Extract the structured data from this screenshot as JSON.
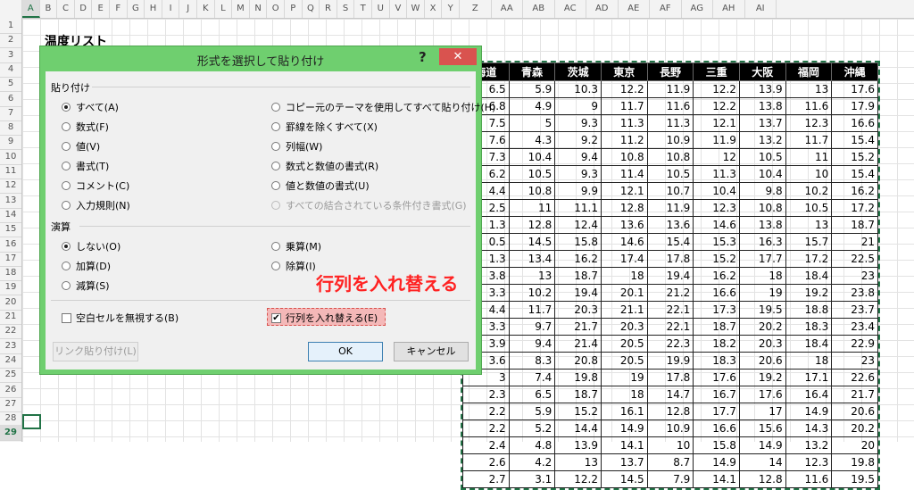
{
  "sheet": {
    "columns": [
      "A",
      "B",
      "C",
      "D",
      "E",
      "F",
      "G",
      "H",
      "I",
      "J",
      "K",
      "L",
      "M",
      "N",
      "O",
      "P",
      "Q",
      "R",
      "S",
      "T",
      "U",
      "V",
      "W",
      "X",
      "Y",
      "Z",
      "AA",
      "AB",
      "AC",
      "AD",
      "AE",
      "AF",
      "AG",
      "AH",
      "AI"
    ],
    "active_column": "A",
    "rows": [
      "1",
      "2",
      "3",
      "4",
      "5",
      "6",
      "7",
      "8",
      "9",
      "10",
      "11",
      "12",
      "13",
      "14",
      "15",
      "16",
      "17",
      "18",
      "19",
      "20",
      "21",
      "22",
      "23",
      "24",
      "25",
      "26",
      "27",
      "28",
      "29"
    ],
    "active_row": "29",
    "title": "温度リスト",
    "table_headers": [
      "海道",
      "青森",
      "茨城",
      "東京",
      "長野",
      "三重",
      "大阪",
      "福岡",
      "沖縄"
    ],
    "table_rows": [
      [
        "6.5",
        "5.9",
        "10.3",
        "12.2",
        "11.9",
        "12.2",
        "13.9",
        "13",
        "17.6"
      ],
      [
        "6.8",
        "4.9",
        "9",
        "11.7",
        "11.6",
        "12.2",
        "13.8",
        "11.6",
        "17.9"
      ],
      [
        "7.5",
        "5",
        "9.3",
        "11.3",
        "11.3",
        "12.1",
        "13.7",
        "12.3",
        "16.6"
      ],
      [
        "7.6",
        "4.3",
        "9.2",
        "11.2",
        "10.9",
        "11.9",
        "13.2",
        "11.7",
        "15.4"
      ],
      [
        "7.3",
        "10.4",
        "9.4",
        "10.8",
        "10.8",
        "12",
        "10.5",
        "11",
        "15.2"
      ],
      [
        "6.2",
        "10.5",
        "9.3",
        "11.4",
        "10.5",
        "11.3",
        "10.4",
        "10",
        "15.4"
      ],
      [
        "4.4",
        "10.8",
        "9.9",
        "12.1",
        "10.7",
        "10.4",
        "9.8",
        "10.2",
        "16.2"
      ],
      [
        "2.5",
        "11",
        "11.1",
        "12.8",
        "11.9",
        "12.3",
        "10.8",
        "10.5",
        "17.2"
      ],
      [
        "1.3",
        "12.8",
        "12.4",
        "13.6",
        "13.6",
        "14.6",
        "13.8",
        "13",
        "18.7"
      ],
      [
        "0.5",
        "14.5",
        "15.8",
        "14.6",
        "15.4",
        "15.3",
        "16.3",
        "15.7",
        "21"
      ],
      [
        "1.3",
        "13.4",
        "16.2",
        "17.4",
        "17.8",
        "15.2",
        "17.7",
        "17.2",
        "22.5"
      ],
      [
        "3.8",
        "13",
        "18.7",
        "18",
        "19.4",
        "16.2",
        "18",
        "18.4",
        "23"
      ],
      [
        "3.3",
        "10.2",
        "19.4",
        "20.1",
        "21.2",
        "16.6",
        "19",
        "19.2",
        "23.8"
      ],
      [
        "4.4",
        "11.7",
        "20.3",
        "21.1",
        "22.1",
        "17.3",
        "19.5",
        "18.8",
        "23.7"
      ],
      [
        "3.3",
        "9.7",
        "21.7",
        "20.3",
        "22.1",
        "18.7",
        "20.2",
        "18.3",
        "23.4"
      ],
      [
        "3.9",
        "9.4",
        "21.4",
        "20.5",
        "22.3",
        "18.2",
        "20.3",
        "18.4",
        "22.9"
      ],
      [
        "3.6",
        "8.3",
        "20.8",
        "20.5",
        "19.9",
        "18.3",
        "20.6",
        "18",
        "23"
      ],
      [
        "3",
        "7.4",
        "19.8",
        "19",
        "17.8",
        "17.6",
        "19.2",
        "17.1",
        "22.6"
      ],
      [
        "2.3",
        "6.5",
        "18.7",
        "18",
        "14.7",
        "16.7",
        "17.6",
        "16.4",
        "21.7"
      ],
      [
        "2.2",
        "5.9",
        "15.2",
        "16.1",
        "12.8",
        "17.7",
        "17",
        "14.9",
        "20.6"
      ],
      [
        "2.2",
        "5.2",
        "14.4",
        "14.9",
        "10.9",
        "16.6",
        "15.6",
        "14.3",
        "20.2"
      ],
      [
        "2.4",
        "4.8",
        "13.9",
        "14.1",
        "10",
        "15.8",
        "14.9",
        "13.2",
        "20"
      ],
      [
        "2.6",
        "4.2",
        "13",
        "13.7",
        "8.7",
        "14.9",
        "14",
        "12.3",
        "19.8"
      ],
      [
        "2.7",
        "3.1",
        "12.2",
        "14.5",
        "7.9",
        "14.1",
        "12.8",
        "11.6",
        "19.5"
      ]
    ]
  },
  "dialog": {
    "title": "形式を選択して貼り付け",
    "help": "?",
    "close": "✕",
    "paste_group": "貼り付け",
    "paste_options_left": [
      {
        "label": "すべて(A)",
        "checked": true
      },
      {
        "label": "数式(F)",
        "checked": false
      },
      {
        "label": "値(V)",
        "checked": false
      },
      {
        "label": "書式(T)",
        "checked": false
      },
      {
        "label": "コメント(C)",
        "checked": false
      },
      {
        "label": "入力規則(N)",
        "checked": false
      }
    ],
    "paste_options_right": [
      {
        "label": "コピー元のテーマを使用してすべて貼り付け(H)",
        "checked": false,
        "disabled": false
      },
      {
        "label": "罫線を除くすべて(X)",
        "checked": false,
        "disabled": false
      },
      {
        "label": "列幅(W)",
        "checked": false,
        "disabled": false
      },
      {
        "label": "数式と数値の書式(R)",
        "checked": false,
        "disabled": false
      },
      {
        "label": "値と数値の書式(U)",
        "checked": false,
        "disabled": false
      },
      {
        "label": "すべての結合されている条件付き書式(G)",
        "checked": false,
        "disabled": true
      }
    ],
    "operation_group": "演算",
    "operation_left": [
      {
        "label": "しない(O)",
        "checked": true
      },
      {
        "label": "加算(D)",
        "checked": false
      },
      {
        "label": "減算(S)",
        "checked": false
      }
    ],
    "operation_right": [
      {
        "label": "乗算(M)",
        "checked": false
      },
      {
        "label": "除算(I)",
        "checked": false
      }
    ],
    "skip_blanks": "空白セルを無視する(B)",
    "transpose": "行列を入れ替える(E)",
    "paste_link": "リンク貼り付け(L)",
    "ok": "OK",
    "cancel": "キャンセル"
  },
  "annotation": "行列を入れ替える"
}
